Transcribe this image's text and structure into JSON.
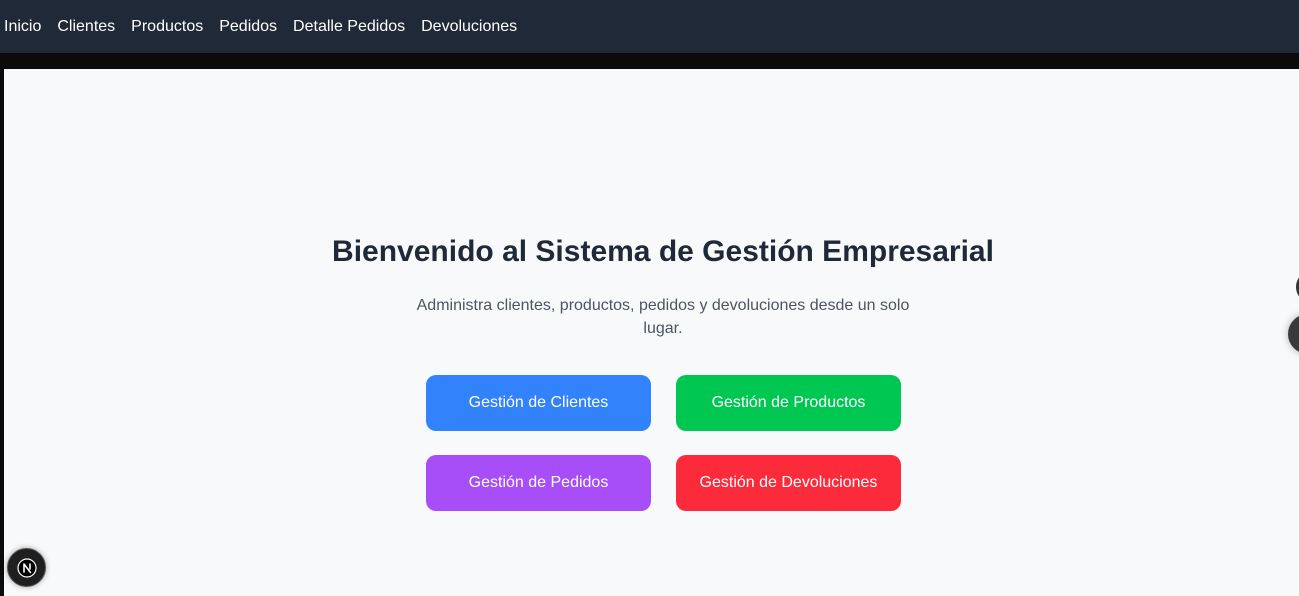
{
  "nav": {
    "items": [
      {
        "label": "Inicio"
      },
      {
        "label": "Clientes"
      },
      {
        "label": "Productos"
      },
      {
        "label": "Pedidos"
      },
      {
        "label": "Detalle Pedidos"
      },
      {
        "label": "Devoluciones"
      }
    ]
  },
  "main": {
    "title": "Bienvenido al Sistema de Gestión Empresarial",
    "subtitle": "Administra clientes, productos, pedidos y devoluciones desde un solo lugar.",
    "buttons": [
      {
        "label": "Gestión de Clientes",
        "color": "#3283fb"
      },
      {
        "label": "Gestión de Productos",
        "color": "#00c752"
      },
      {
        "label": "Gestión de Pedidos",
        "color": "#a84ef9"
      },
      {
        "label": "Gestión de Devoluciones",
        "color": "#fc2b3b"
      }
    ]
  },
  "dev_badge": {
    "icon": "nextjs-logo-icon",
    "letter": "N"
  },
  "colors": {
    "navbar": "#1f2937",
    "background": "#f8f9fb",
    "title": "#1f2937"
  }
}
